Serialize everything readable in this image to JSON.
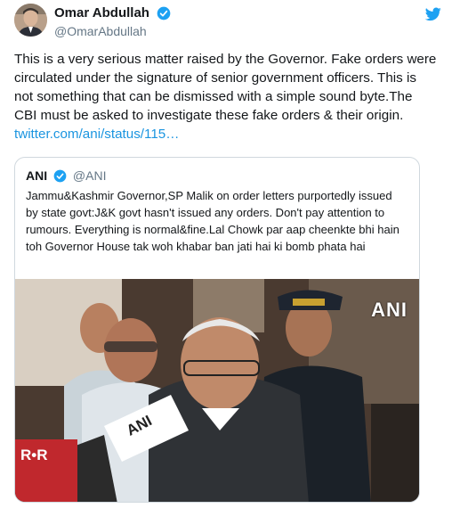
{
  "author": {
    "display_name": "Omar Abdullah",
    "handle": "@OmarAbdullah"
  },
  "tweet": {
    "text": "This is a very serious matter raised by the Governor. Fake orders were circulated under the signature of senior government officers. This is not something that can be dismissed with a simple sound byte.The CBI must be asked to investigate these fake orders & their origin. ",
    "link": "twitter.com/ani/status/115…"
  },
  "quote": {
    "display_name": "ANI",
    "handle": "@ANI",
    "text": "Jammu&Kashmir Governor,SP Malik on order letters purportedly issued by state govt:J&K govt hasn't issued any orders. Don't pay attention to rumours. Everything is normal&fine.Lal Chowk par aap cheenkte bhi hain toh Governor House tak woh khabar ban jati hai ki bomb phata hai",
    "image": {
      "watermark": "ANI",
      "mic_label": "ANI",
      "mic2_label": "R•R"
    }
  },
  "icons": {
    "verified": "verified-badge-icon",
    "bird": "twitter-bird-icon"
  },
  "colors": {
    "link": "#1b95e0",
    "verified": "#1da1f2",
    "muted": "#657786"
  }
}
